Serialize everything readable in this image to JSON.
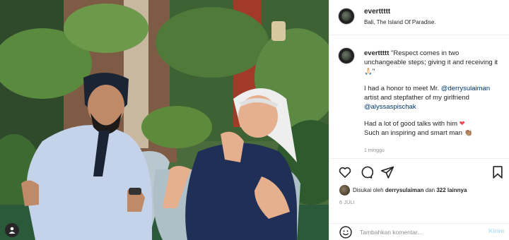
{
  "photo": {
    "alt_icon": "user-tag-icon"
  },
  "post": {
    "username": "everttttt",
    "location": "Bali, The Island Of Paradise.",
    "caption_username": "everttttt",
    "caption_line1": "\"Respect comes in two unchangeable steps; giving it and receiving it 🙏🏻\"",
    "caption_p2_a": "I had a honor to meet Mr. ",
    "mention1": "@derrysulaiman",
    "caption_p2_b": " artist and stepfather of my girlfriend ",
    "mention2": "@alyssaspischak",
    "caption_p3_a": "Had a lot of good talks with him ",
    "heart_emoji": "❤",
    "caption_p3_b": "Such an inspiring and smart man ",
    "hands_emoji": "👏🏽",
    "time_small": "1 minggu"
  },
  "actions": {
    "icons": [
      "heart-icon",
      "comment-icon",
      "share-icon",
      "bookmark-icon"
    ],
    "likes_prefix": "Disukai oleh ",
    "likes_user": "derrysulaiman",
    "likes_middle": " dan ",
    "likes_count": "322 lainnya",
    "date": "6 JULI"
  },
  "comment_bar": {
    "placeholder": "Tambahkan komentar...",
    "post_label": "Kirim"
  },
  "colors": {
    "link": "#00376b",
    "muted": "#8e8e8e",
    "post_disabled": "#b2dffc",
    "heart": "#ed4956"
  }
}
